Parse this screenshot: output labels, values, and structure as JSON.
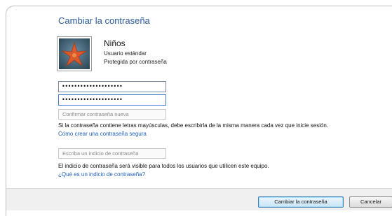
{
  "title": "Cambiar la contraseña",
  "user": {
    "name": "Niños",
    "type": "Usuario estándar",
    "protection": "Protegida por contraseña"
  },
  "fields": {
    "new_password_value": "••••••••••••••••••••",
    "confirm_password_value": "••••••••••••••••••••",
    "confirm_placeholder": "Confirmar contraseña nueva",
    "hint_placeholder": "Escriba un indicio de contraseña"
  },
  "info": {
    "case_notice": "Si la contraseña contiene letras mayúsculas, debe escribirla de la misma manera cada vez que inicie sesión.",
    "create_secure_link": "Cómo crear una contraseña segura",
    "hint_notice": "El indicio de contraseña será visible para todos los usuarios que utilicen este equipo.",
    "what_is_hint_link": "¿Qué es un indicio de contraseña?"
  },
  "buttons": {
    "change": "Cambiar la contraseña",
    "cancel": "Cancelar"
  },
  "colors": {
    "title": "#2a5a9a",
    "link": "#2060c0"
  },
  "icons": {
    "avatar": "starfish-avatar-icon"
  }
}
